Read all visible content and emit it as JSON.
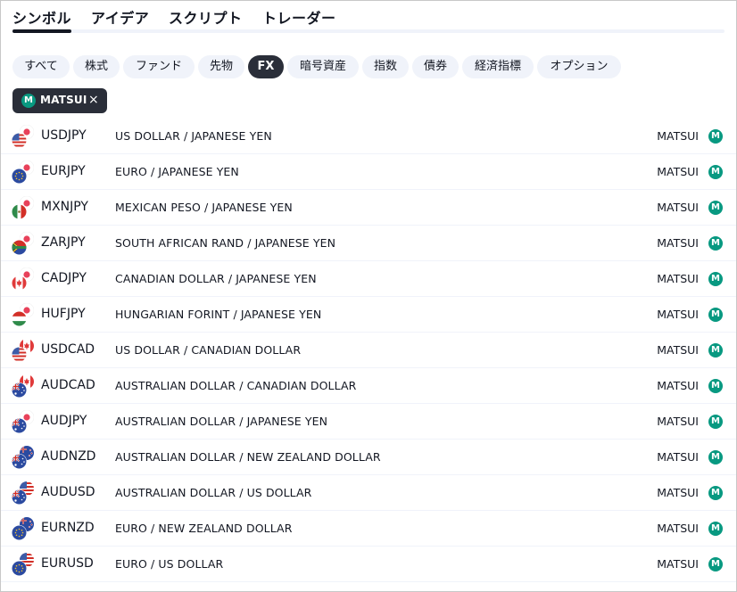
{
  "tabs": [
    {
      "label": "シンボル",
      "active": true
    },
    {
      "label": "アイデア",
      "active": false
    },
    {
      "label": "スクリプト",
      "active": false
    },
    {
      "label": "トレーダー",
      "active": false
    }
  ],
  "chips": [
    {
      "label": "すべて",
      "active": false
    },
    {
      "label": "株式",
      "active": false
    },
    {
      "label": "ファンド",
      "active": false
    },
    {
      "label": "先物",
      "active": false
    },
    {
      "label": "FX",
      "active": true
    },
    {
      "label": "暗号資産",
      "active": false
    },
    {
      "label": "指数",
      "active": false
    },
    {
      "label": "債券",
      "active": false
    },
    {
      "label": "経済指標",
      "active": false
    },
    {
      "label": "オプション",
      "active": false
    }
  ],
  "source_filter": {
    "badge": "M",
    "label": "MATSUI",
    "close_icon": "×"
  },
  "rows": [
    {
      "symbol": "USDJPY",
      "description": "US DOLLAR / JAPANESE YEN",
      "source": "MATSUI",
      "badge": "M",
      "base_flag": "us",
      "quote_flag": "jp"
    },
    {
      "symbol": "EURJPY",
      "description": "EURO / JAPANESE YEN",
      "source": "MATSUI",
      "badge": "M",
      "base_flag": "eu",
      "quote_flag": "jp"
    },
    {
      "symbol": "MXNJPY",
      "description": "MEXICAN PESO / JAPANESE YEN",
      "source": "MATSUI",
      "badge": "M",
      "base_flag": "mx",
      "quote_flag": "jp"
    },
    {
      "symbol": "ZARJPY",
      "description": "SOUTH AFRICAN RAND / JAPANESE YEN",
      "source": "MATSUI",
      "badge": "M",
      "base_flag": "za",
      "quote_flag": "jp"
    },
    {
      "symbol": "CADJPY",
      "description": "CANADIAN DOLLAR / JAPANESE YEN",
      "source": "MATSUI",
      "badge": "M",
      "base_flag": "ca",
      "quote_flag": "jp"
    },
    {
      "symbol": "HUFJPY",
      "description": "HUNGARIAN FORINT / JAPANESE YEN",
      "source": "MATSUI",
      "badge": "M",
      "base_flag": "hu",
      "quote_flag": "jp"
    },
    {
      "symbol": "USDCAD",
      "description": "US DOLLAR / CANADIAN DOLLAR",
      "source": "MATSUI",
      "badge": "M",
      "base_flag": "us",
      "quote_flag": "ca"
    },
    {
      "symbol": "AUDCAD",
      "description": "AUSTRALIAN DOLLAR / CANADIAN DOLLAR",
      "source": "MATSUI",
      "badge": "M",
      "base_flag": "au",
      "quote_flag": "ca"
    },
    {
      "symbol": "AUDJPY",
      "description": "AUSTRALIAN DOLLAR / JAPANESE YEN",
      "source": "MATSUI",
      "badge": "M",
      "base_flag": "au",
      "quote_flag": "jp"
    },
    {
      "symbol": "AUDNZD",
      "description": "AUSTRALIAN DOLLAR / NEW ZEALAND DOLLAR",
      "source": "MATSUI",
      "badge": "M",
      "base_flag": "au",
      "quote_flag": "nz"
    },
    {
      "symbol": "AUDUSD",
      "description": "AUSTRALIAN DOLLAR / US DOLLAR",
      "source": "MATSUI",
      "badge": "M",
      "base_flag": "au",
      "quote_flag": "us"
    },
    {
      "symbol": "EURNZD",
      "description": "EURO / NEW ZEALAND DOLLAR",
      "source": "MATSUI",
      "badge": "M",
      "base_flag": "eu",
      "quote_flag": "nz"
    },
    {
      "symbol": "EURUSD",
      "description": "EURO / US DOLLAR",
      "source": "MATSUI",
      "badge": "M",
      "base_flag": "eu",
      "quote_flag": "us"
    }
  ],
  "colors": {
    "accent_dark": "#2a2e39",
    "badge_green": "#089981",
    "chip_bg": "#f0f3fa"
  }
}
